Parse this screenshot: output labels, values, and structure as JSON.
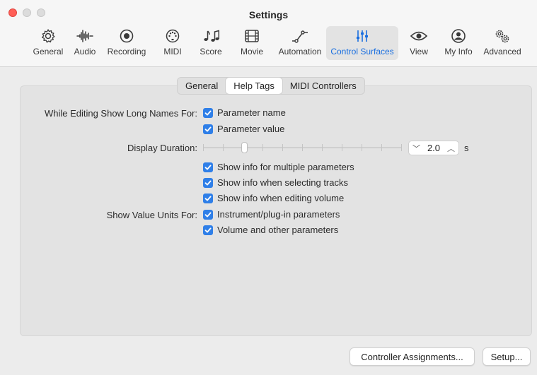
{
  "window": {
    "title": "Settings"
  },
  "toolbar": {
    "items": [
      {
        "label": "General",
        "icon": "gear-icon"
      },
      {
        "label": "Audio",
        "icon": "waveform-icon"
      },
      {
        "label": "Recording",
        "icon": "record-icon"
      },
      {
        "label": "MIDI",
        "icon": "midi-port-icon"
      },
      {
        "label": "Score",
        "icon": "music-notes-icon"
      },
      {
        "label": "Movie",
        "icon": "film-icon"
      },
      {
        "label": "Automation",
        "icon": "automation-curve-icon"
      },
      {
        "label": "Control Surfaces",
        "icon": "sliders-icon"
      },
      {
        "label": "View",
        "icon": "eye-icon"
      },
      {
        "label": "My Info",
        "icon": "person-icon"
      },
      {
        "label": "Advanced",
        "icon": "gears-icon"
      }
    ],
    "selected": "Control Surfaces"
  },
  "tabs": {
    "items": [
      "General",
      "Help Tags",
      "MIDI Controllers"
    ],
    "selected": "Help Tags"
  },
  "help_tags": {
    "long_names_label": "While Editing Show Long Names For:",
    "parameter_name": "Parameter name",
    "parameter_value": "Parameter value",
    "display_duration_label": "Display Duration:",
    "duration_value": "2.0",
    "duration_unit": "s",
    "duration_slider_position": 0.2,
    "multiple_params": "Show info for multiple parameters",
    "selecting_tracks": "Show info when selecting tracks",
    "editing_volume": "Show info when editing volume",
    "value_units_label": "Show Value Units For:",
    "instrument_params": "Instrument/plug-in parameters",
    "volume_params": "Volume and other parameters"
  },
  "checked": {
    "parameter_name": true,
    "parameter_value": true,
    "multiple_params": true,
    "selecting_tracks": true,
    "editing_volume": true,
    "instrument_params": true,
    "volume_params": true
  },
  "buttons": {
    "controller_assignments": "Controller Assignments...",
    "setup": "Setup..."
  },
  "colors": {
    "accent": "#2f7fe8",
    "close": "#ff5f57"
  }
}
